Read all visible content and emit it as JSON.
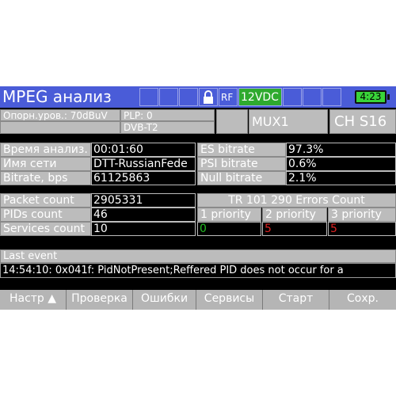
{
  "header": {
    "title": "MPEG анализ",
    "rf_label": "RF",
    "power_label": "12VDC",
    "battery_time": "4:23",
    "colors": {
      "header_bg": "#4a5cd8",
      "power_bg": "#2eaa2e",
      "battery": "#39d439"
    }
  },
  "info": {
    "ref_level": "Опорн.уров.: 70dBuV",
    "plp": "PLP: 0",
    "standard": "DVB-T2",
    "mux": "MUX1",
    "channel": "CH S16"
  },
  "params_left": [
    {
      "label": "Время анализ.",
      "value": "00:01:60"
    },
    {
      "label": "Имя сети",
      "value": "DTT-RussianFede"
    },
    {
      "label": "Bitrate, bps",
      "value": "61125863"
    }
  ],
  "params_right": [
    {
      "label": "ES bitrate",
      "value": "97.3%"
    },
    {
      "label": "PSI bitrate",
      "value": "0.6%"
    },
    {
      "label": "Null bitrate",
      "value": "2.1%"
    }
  ],
  "counts": [
    {
      "label": "Packet count",
      "value": "2905331"
    },
    {
      "label": "PIDs count",
      "value": "46"
    },
    {
      "label": "Services count",
      "value": "10"
    }
  ],
  "tr_errors": {
    "title": "TR 101 290 Errors Count",
    "priorities": [
      {
        "label": "1 priority",
        "value": "0",
        "color": "#22bb22"
      },
      {
        "label": "2 priority",
        "value": "5",
        "color": "#dd2222"
      },
      {
        "label": "3 priority",
        "value": "5",
        "color": "#dd2222"
      }
    ]
  },
  "last_event": {
    "label": "Last event",
    "text": "14:54:10: 0x041f: PidNotPresent;Reffered PID does not occur for a"
  },
  "softkeys": [
    {
      "label": "Настр ▲"
    },
    {
      "label": "Проверка"
    },
    {
      "label": "Ошибки"
    },
    {
      "label": "Сервисы"
    },
    {
      "label": "Старт"
    },
    {
      "label": "Сохр."
    }
  ]
}
